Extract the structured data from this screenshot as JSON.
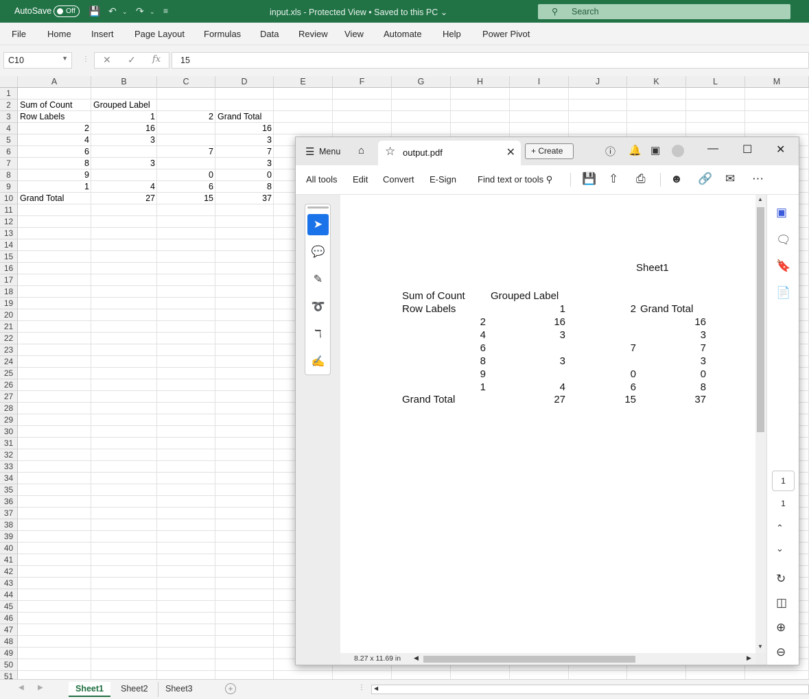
{
  "excel": {
    "autosave_label": "AutoSave",
    "autosave_state": "Off",
    "title": "input.xls  -  Protected View • Saved to this PC",
    "search_placeholder": "Search",
    "ribbon_tabs": [
      "File",
      "Home",
      "Insert",
      "Page Layout",
      "Formulas",
      "Data",
      "Review",
      "View",
      "Automate",
      "Help",
      "Power Pivot"
    ],
    "name_box": "C10",
    "formula_value": "15",
    "columns": [
      "A",
      "B",
      "C",
      "D",
      "E",
      "F",
      "G",
      "H",
      "I",
      "J",
      "K",
      "L",
      "M"
    ],
    "rows": [
      "1",
      "2",
      "3",
      "4",
      "5",
      "6",
      "7",
      "8",
      "9",
      "10",
      "11",
      "12",
      "13",
      "14",
      "15",
      "16",
      "17",
      "18",
      "19",
      "20",
      "21",
      "22",
      "23",
      "24",
      "25",
      "26",
      "27",
      "28",
      "29",
      "30",
      "31",
      "32",
      "33",
      "34",
      "35",
      "36",
      "37",
      "38",
      "39",
      "40",
      "41",
      "42",
      "43",
      "44",
      "45",
      "46",
      "47",
      "48",
      "49",
      "50",
      "51"
    ],
    "cells": {
      "A2": "Sum of Count",
      "B2": "Grouped Label",
      "A3": "Row Labels",
      "B3": "1",
      "C3": "2",
      "D3": "Grand Total",
      "A4": "2",
      "B4": "16",
      "D4": "16",
      "A5": "4",
      "B5": "3",
      "D5": "3",
      "A6": "6",
      "C6": "7",
      "D6": "7",
      "A7": "8",
      "B7": "3",
      "D7": "3",
      "A8": "9",
      "C8": "0",
      "D8": "0",
      "A9": "1",
      "B9": "4",
      "C9": "6",
      "D9": "8",
      "A10": "Grand Total",
      "B10": "27",
      "C10": "15",
      "D10": "37"
    },
    "sheets": [
      "Sheet1",
      "Sheet2",
      "Sheet3"
    ],
    "active_sheet": "Sheet1"
  },
  "pdf": {
    "menu_label": "Menu",
    "tab_name": "output.pdf",
    "create_label": "Create",
    "tools": [
      "All tools",
      "Edit",
      "Convert",
      "E-Sign"
    ],
    "find_label": "Find text or tools",
    "page": {
      "sheet_title": "Sheet1",
      "header1": {
        "a": "Sum of Count",
        "b": "Grouped Label"
      },
      "header2": {
        "a": "Row Labels",
        "b": "1",
        "c": "2",
        "d": "Grand Total"
      },
      "rows": [
        {
          "a": "2",
          "b": "16",
          "c": "",
          "d": "16"
        },
        {
          "a": "4",
          "b": "3",
          "c": "",
          "d": "3"
        },
        {
          "a": "6",
          "b": "",
          "c": "7",
          "d": "7"
        },
        {
          "a": "8",
          "b": "3",
          "c": "",
          "d": "3"
        },
        {
          "a": "9",
          "b": "",
          "c": "0",
          "d": "0"
        },
        {
          "a": "1",
          "b": "4",
          "c": "6",
          "d": "8"
        }
      ],
      "total": {
        "a": "Grand Total",
        "b": "27",
        "c": "15",
        "d": "37"
      }
    },
    "page_size": "8.27 x 11.69 in",
    "current_page": "1",
    "page_count": "1"
  }
}
